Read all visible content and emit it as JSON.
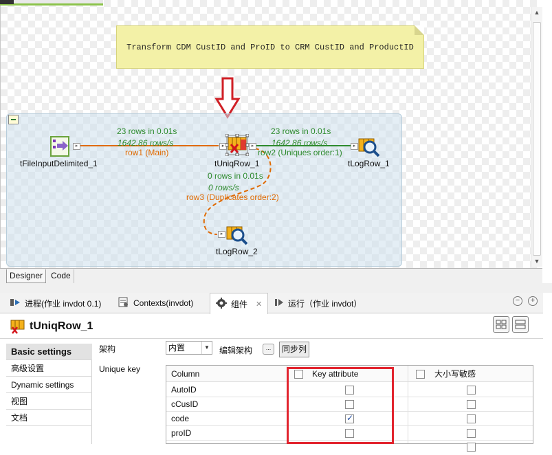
{
  "note": {
    "text": "Transform CDM CustID and ProID to CRM CustID and ProductID"
  },
  "components": {
    "input": {
      "label": "tFileInputDelimited_1"
    },
    "uniq": {
      "label": "tUniqRow_1"
    },
    "log1": {
      "label": "tLogRow_1"
    },
    "log2": {
      "label": "tLogRow_2"
    }
  },
  "links": {
    "row1": {
      "rows": "23 rows in 0.01s",
      "rate": "1642.86 rows/s",
      "label": "row1 (Main)"
    },
    "row2": {
      "rows": "23 rows in 0.01s",
      "rate": "1642.86 rows/s",
      "label": "row2 (Uniques order:1)"
    },
    "row3": {
      "rows": "0 rows in 0.01s",
      "rate": "0 rows/s",
      "label": "row3 (Duplicates order:2)"
    }
  },
  "editor_tabs": [
    "Designer",
    "Code"
  ],
  "view_tabs": [
    {
      "label": "进程(作业 invdot 0.1)",
      "icon": "run-process-icon"
    },
    {
      "label": "Contexts(invdot)",
      "icon": "contexts-icon"
    },
    {
      "label": "组件",
      "icon": "component-icon",
      "active": true
    },
    {
      "label": "运行（作业 invdot）",
      "icon": "run-icon"
    }
  ],
  "component_title": "tUniqRow_1",
  "settings_menu": [
    "Basic settings",
    "高级设置",
    "Dynamic settings",
    "视图",
    "文档"
  ],
  "form": {
    "schema_label": "架构",
    "schema_value": "内置",
    "edit_schema_label": "编辑架构",
    "edit_schema_button": "...",
    "sync_button": "同步列",
    "unique_key_label": "Unique key"
  },
  "key_table": {
    "headers": [
      "Column",
      "Key attribute",
      "大小写敏感"
    ],
    "rows": [
      {
        "column": "AutoID",
        "key": false,
        "case": false
      },
      {
        "column": "cCusID",
        "key": false,
        "case": false
      },
      {
        "column": "code",
        "key": true,
        "case": false
      },
      {
        "column": "proID",
        "key": false,
        "case": false
      }
    ]
  },
  "colors": {
    "main_link": "#e06a00",
    "uniques_link": "#2e8b2e",
    "highlight_box": "#e2242e",
    "note_bg": "#f3f1a7"
  }
}
